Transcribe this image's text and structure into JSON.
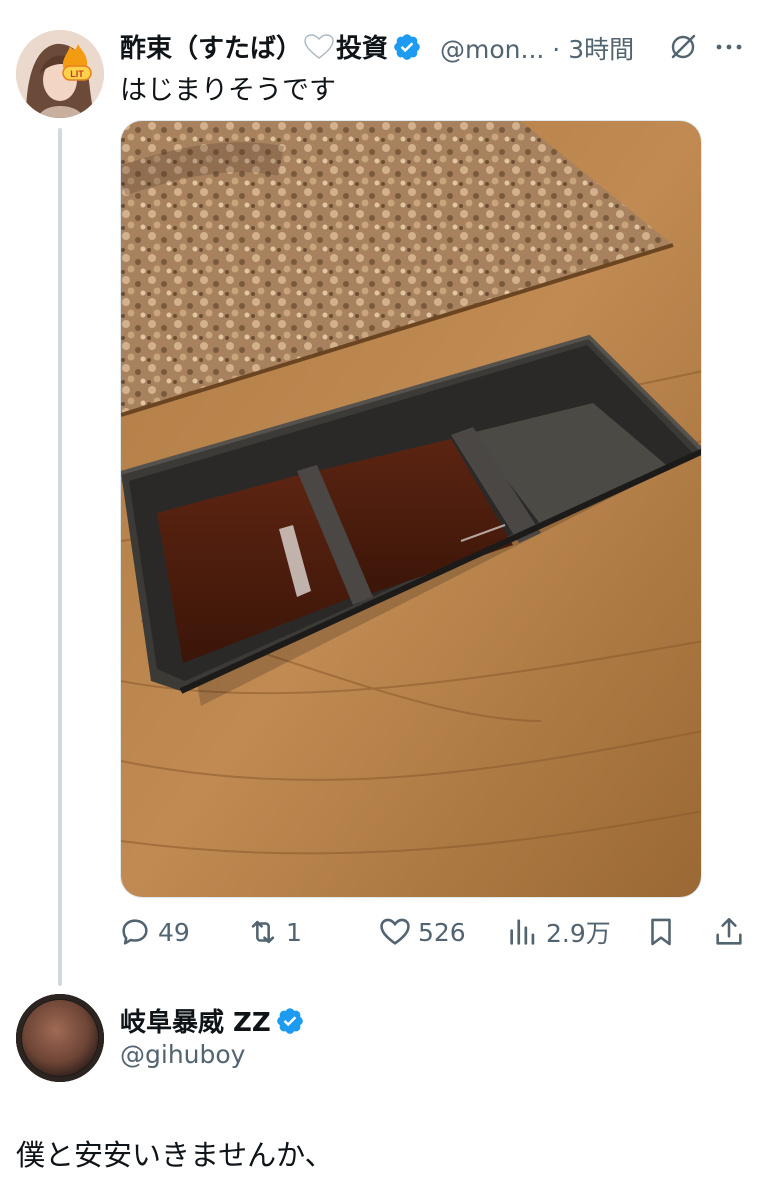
{
  "tweet1": {
    "display_name_before": "酢束（すたば）",
    "display_name_after": "投資",
    "handle": "@mon...",
    "time": "· 3時間",
    "text": "はじまりそうです",
    "actions": {
      "replies": "49",
      "retweets": "1",
      "likes": "526",
      "views": "2.9万"
    }
  },
  "tweet2": {
    "display_name": "岐阜暴威 ZZ",
    "handle": "@gihuboy",
    "text": "僕と安安いきませんか、"
  },
  "colors": {
    "verified_blue": "#1d9bf0",
    "secondary_text": "#536471",
    "thread_line": "#cfd9de"
  },
  "avatar1_badge": "LIT"
}
